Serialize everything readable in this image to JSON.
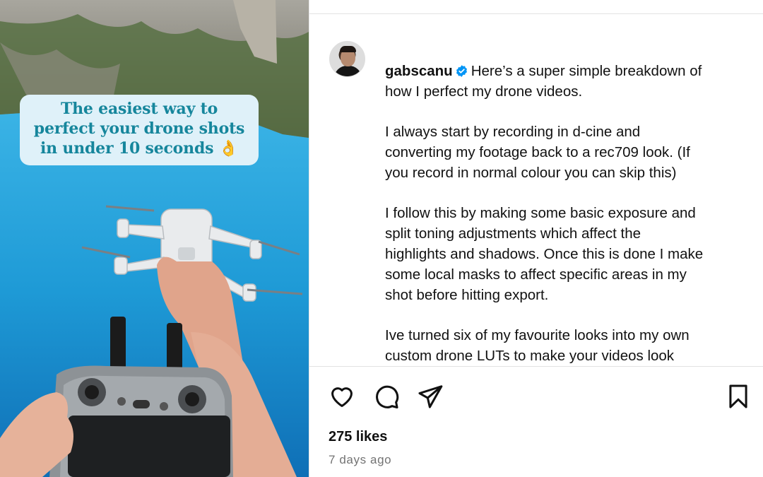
{
  "media": {
    "overlay_lines": [
      "The easiest way to",
      "perfect your drone shots",
      "in under 10 seconds 👌"
    ]
  },
  "author": {
    "username": "gabscanu",
    "verified": true
  },
  "caption": {
    "first_paragraph_after_username": "Here’s a super simple breakdown of\nhow I perfect my drone videos.",
    "paragraphs": [
      "I always start by recording in d-cine and\nconverting my footage back to a rec709 look. (If\nyou record in normal colour you can skip this)",
      "I follow this by making some basic exposure and\nsplit toning adjustments which affect the\nhighlights and shadows. Once this is done I make\nsome local masks to affect specific areas in my\nshot before hitting export.",
      "Ive turned six of my favourite looks into my own\ncustom drone LUTs to make your videos look\nprofessional and cinematic with just a few clicks,"
    ]
  },
  "actions": {
    "icons": [
      "heart-icon",
      "comment-icon",
      "share-icon",
      "bookmark-icon"
    ]
  },
  "stats": {
    "likes": "275 likes",
    "posted": "7 days ago"
  },
  "colors": {
    "overlay_bg": "#dff1f9",
    "overlay_text": "#16869c",
    "verified_blue": "#0095f6",
    "sea": "#1e9ad6"
  }
}
